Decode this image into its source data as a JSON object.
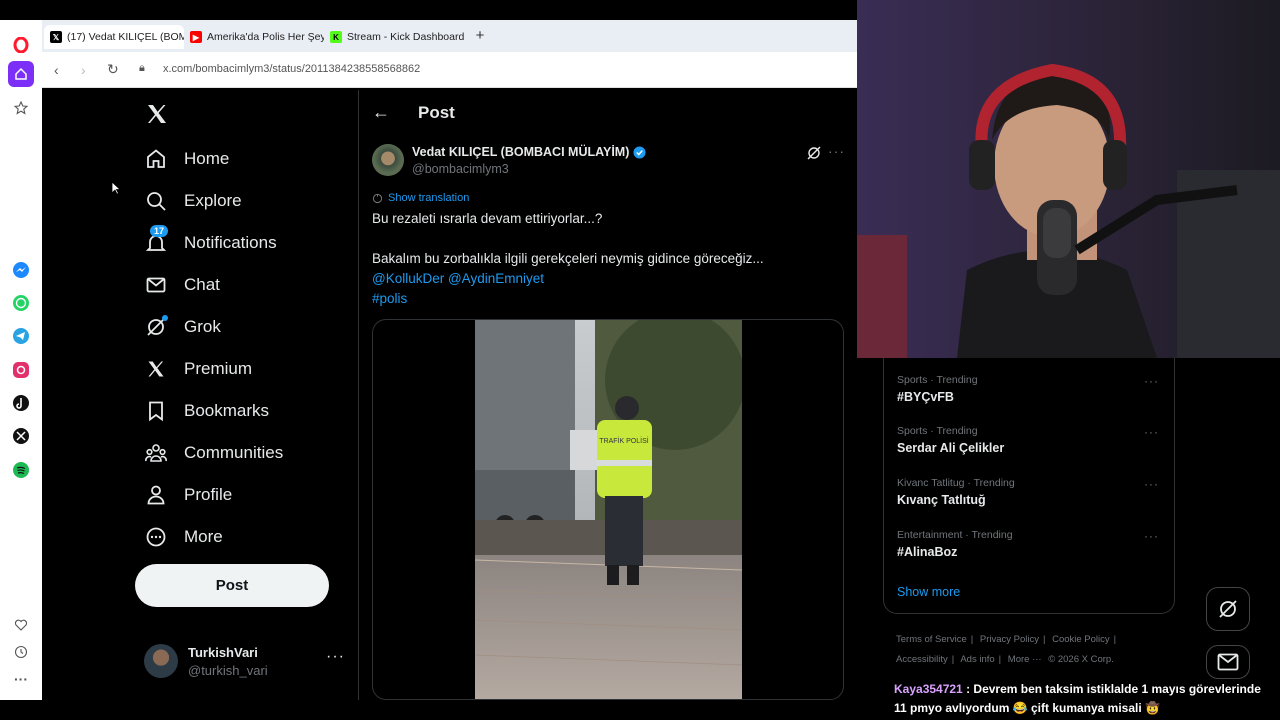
{
  "browser": {
    "tabs": [
      {
        "label": "(17) Vedat KILIÇEL (BOMB",
        "icon": "x-logo-icon"
      },
      {
        "label": "Amerika'da Polis Her Şeyi",
        "icon": "youtube-icon"
      },
      {
        "label": "Stream - Kick Dashboard",
        "icon": "kick-icon"
      }
    ],
    "new_tab": "+",
    "url": "x.com/bombacimlym3/status/2011384238558568862"
  },
  "x": {
    "nav": [
      {
        "label": "Home",
        "icon": "home-icon"
      },
      {
        "label": "Explore",
        "icon": "search-icon"
      },
      {
        "label": "Notifications",
        "icon": "bell-icon",
        "badge": "17"
      },
      {
        "label": "Chat",
        "icon": "mail-icon"
      },
      {
        "label": "Grok",
        "icon": "grok-icon"
      },
      {
        "label": "Premium",
        "icon": "x-logo-icon"
      },
      {
        "label": "Bookmarks",
        "icon": "bookmark-icon"
      },
      {
        "label": "Communities",
        "icon": "people-icon"
      },
      {
        "label": "Profile",
        "icon": "person-icon"
      },
      {
        "label": "More",
        "icon": "more-circle-icon"
      }
    ],
    "post_button": "Post",
    "account": {
      "name": "TurkishVari",
      "handle": "@turkish_vari",
      "menu": "···"
    },
    "post_header": "Post",
    "post": {
      "author": "Vedat KILIÇEL (BOMBACI MÜLAYİM)",
      "handle": "@bombacimlym3",
      "show_translation": "Show translation",
      "line1": "Bu rezaleti ısrarla devam ettiriyorlar...?",
      "line2": "Bakalım bu zorbalıkla ilgili gerekçeleri neymiş gidince göreceğiz...",
      "mentions": "@KollukDer @AydinEmniyet",
      "hashtag": "#polis",
      "more": "···",
      "vest_text": "TRAFİK POLİSİ"
    },
    "trends": [
      {
        "meta": "Sports · Trending",
        "name": "#BYÇvFB"
      },
      {
        "meta": "Sports · Trending",
        "name": "Serdar Ali Çelikler"
      },
      {
        "meta": "Kivanc Tatlitug · Trending",
        "name": "Kıvanç Tatlıtuğ"
      },
      {
        "meta": "Entertainment · Trending",
        "name": "#AlinaBoz"
      }
    ],
    "trend_menu": "···",
    "show_more": "Show more",
    "footer": [
      "Terms of Service",
      "Privacy Policy",
      "Cookie Policy",
      "Accessibility",
      "Ads info",
      "More ···",
      "© 2026 X Corp."
    ],
    "footer_sep": "|"
  },
  "chat": {
    "user": "Kaya354721",
    "message": " : Devrem ben taksim istiklalde 1 mayıs görevlerinde 11 pmyo avlıyordum 😂 çift kumanya misali 🤠"
  },
  "colors": {
    "accent": "#1d9bf0",
    "chat_user": "#d9a2ff",
    "opera_red": "#ff1b2d"
  }
}
